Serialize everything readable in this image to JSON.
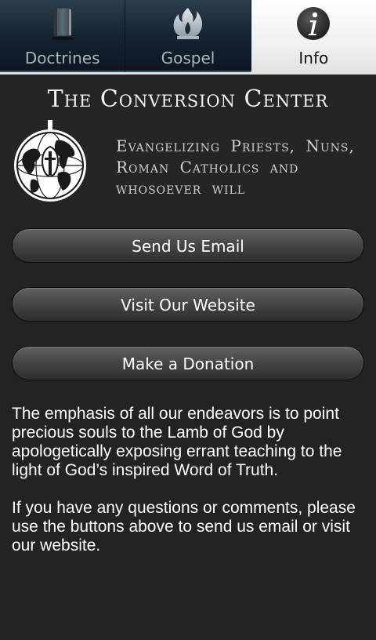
{
  "tabs": [
    {
      "label": "Doctrines",
      "icon": "bible-book-icon",
      "active": false
    },
    {
      "label": "Gospel",
      "icon": "flame-icon",
      "active": false
    },
    {
      "label": "Info",
      "icon": "info-icon",
      "active": true
    }
  ],
  "banner": {
    "title": "The Conversion Center",
    "tagline": "Evangelizing Priests, Nuns, Roman Catholics and whosoever will",
    "logo_icon": "globe-cross-logo"
  },
  "buttons": {
    "email": "Send Us Email",
    "website": "Visit Our Website",
    "donate": "Make a Donation"
  },
  "content": {
    "paragraph_1": "The emphasis of all our endeavors is to point precious souls to the Lamb of God by apologetically exposing errant teaching to the light of God’s inspired Word of Truth.",
    "paragraph_2": "If you have any questions or comments, please use the buttons above to send us email or visit our website."
  },
  "colors": {
    "tab_inactive_bg": "#142230",
    "tab_active_bg": "#f1f1f1",
    "page_bg": "#232323",
    "button_bg": "#474747"
  }
}
